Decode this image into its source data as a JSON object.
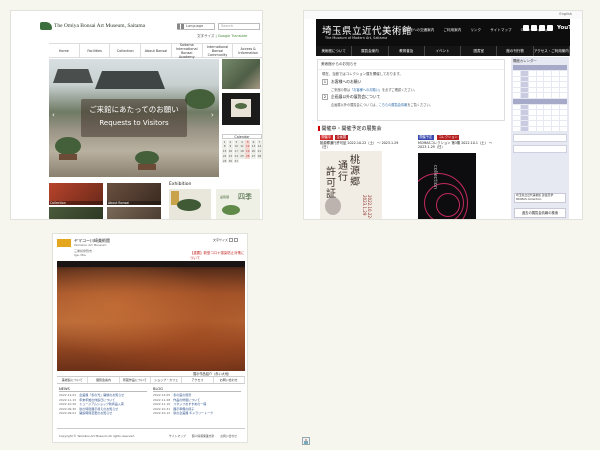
{
  "bonsai": {
    "site_title": "The Omiya Bonsai Art Museum, Saitama",
    "language_label": "Language",
    "search_placeholder": "Search",
    "translate_text": "文字サイズ",
    "translate_brand": "Google Translate",
    "nav": [
      "Home",
      "Facilities",
      "Collection",
      "About Bonsai",
      "Saitama International Bonsai Academy",
      "International Bonsai Community",
      "Access & Information"
    ],
    "hero_title_jp": "ご来館にあたってのお願い",
    "hero_title_en": "Requests to Visitors",
    "calendar_caption": "Calendar",
    "calendar_days": [
      "1",
      "2",
      "3",
      "4",
      "5",
      "6",
      "7",
      "8",
      "9",
      "10",
      "11",
      "12",
      "13",
      "14",
      "15",
      "16",
      "17",
      "18",
      "19",
      "20",
      "21",
      "22",
      "23",
      "24",
      "25",
      "26",
      "27",
      "28",
      "29",
      "30",
      "31"
    ],
    "closed_days": [
      "5",
      "12",
      "19",
      "26"
    ],
    "thumbs": [
      {
        "label": "Collection",
        "color": "#b9432b"
      },
      {
        "label": "About Bonsai",
        "color": "#6a5040"
      },
      {
        "label": "",
        "color": "#4b5b3c"
      },
      {
        "label": "",
        "color": "#7a6a58"
      }
    ],
    "exhibition_title": "Exhibition",
    "exhibit_kanji": "四季",
    "exhibit_label": "盆栽展"
  },
  "saitama": {
    "topbar_text": "English",
    "title_jp": "埼玉県立近代美術館",
    "title_en": "The Museum of Modern Art, Saitama",
    "links": [
      "美術館への交通案内",
      "ご利用案内",
      "リンク",
      "サイトマップ",
      "Other Languages"
    ],
    "youtube": "YouTube",
    "nav": [
      "美術館について",
      "展覧会案内",
      "教育普及",
      "イベント",
      "図書室",
      "館の刊行物",
      "アクセス・ご利用案内"
    ],
    "news_header": "美術館からのお知らせ",
    "news_intro": "現在、当館ではコレクション展を開催しております。",
    "news_items": [
      {
        "num": "1",
        "title": "お客様へのお願い",
        "sub": "ご来館の際は",
        "link": "「お客様へのお願い」",
        "tail": "を必ずご確認ください。"
      },
      {
        "num": "2",
        "title": "企画展以外の展覧会について",
        "sub": "企画展以外の展覧会については、",
        "link": "こちらの展覧会情報",
        "tail": "をご覧ください。"
      }
    ],
    "calendar_title": "開館カレンダー",
    "exhibitions_header": "開催中・開催予定の展覧会",
    "exh1_tags": [
      "開催中",
      "企画展"
    ],
    "exh1_caption": "桃源郷通行許可証 2022.10.22（土） 〜 2023.1.29（日）",
    "exh1_poster": [
      "桃",
      "源",
      "郷",
      "通",
      "行",
      "許",
      "可",
      "証"
    ],
    "exh1_date": "2022.10.22-2023.1.29",
    "exh2_tags": [
      "開催予定",
      "コレクション"
    ],
    "exh2_caption": "MOMASコレクション 第3期 2022.10.1（土） 〜 2023.1.29（日）",
    "exh2_poster_word": "collection",
    "banner_a": "埼玉県立近代美術館 建築見学 MOMAS Collection",
    "banner_b": "過去の展覧会情報の検索"
  },
  "yamaguchi": {
    "logo_name": "ヤマコー川崎美術館",
    "logo_sub": "Yamakoo Art Museum",
    "logo_sub2": "三重県伊賀市",
    "logo_sub3": "Iga, Mie",
    "font_size_label": "文字サイズ",
    "notice": "【重要】新型コロナ感染防止対策について",
    "hero_caption": "展示作品紹介（赤い大地）",
    "nav": [
      "美術館について",
      "展覧会案内",
      "所蔵作品について",
      "ショップ・カフェ",
      "アクセス",
      "お問い合わせ"
    ],
    "news_title": "NEWS",
    "news": [
      {
        "date": "2022.12.01",
        "text": "企画展「冬の光」開催のお知らせ"
      },
      {
        "date": "2022.11.15",
        "text": "年末年始の休館日について"
      },
      {
        "date": "2022.10.20",
        "text": "ミュージアムショップ新商品入荷"
      },
      {
        "date": "2022.09.30",
        "text": "秋の特別展示替えのお知らせ"
      },
      {
        "date": "2022.09.01",
        "text": "開館時間変更のお知らせ"
      }
    ],
    "blog_title": "BLOG",
    "blog": [
      {
        "date": "2022.12.05",
        "text": "冬の庭の風景"
      },
      {
        "date": "2022.11.28",
        "text": "作品の修復について"
      },
      {
        "date": "2022.11.10",
        "text": "スタッフおすすめの一冊"
      },
      {
        "date": "2022.10.31",
        "text": "展示準備の様子"
      },
      {
        "date": "2022.10.12",
        "text": "秋の企画展 ギャラリートーク"
      }
    ],
    "copyright": "Copyright © Yamakoo Art Museum All rights reserved.",
    "footer_links": [
      "サイトマップ",
      "個人情報保護方針",
      "お問い合わせ"
    ]
  },
  "broken_image_icon": "broken-image-icon"
}
